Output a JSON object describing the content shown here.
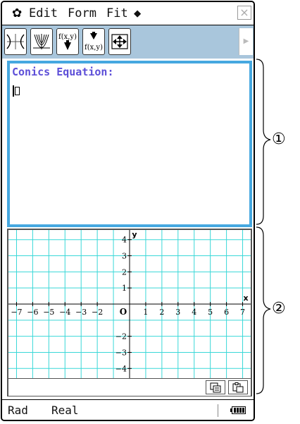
{
  "menu": {
    "gear_icon": "gear-icon",
    "items": [
      "Edit",
      "Form",
      "Fit",
      "◆"
    ],
    "close_label": "×"
  },
  "toolbar": {
    "buttons": [
      "hyperbola-icon",
      "parabola-family-icon",
      "f(x,y) down",
      "f(x,y) up",
      "fullscreen-icon"
    ],
    "scroll_right": "▶"
  },
  "equation_panel": {
    "title": "Conics Equation:",
    "input_value": ""
  },
  "graph": {
    "x_ticks": [
      "−7",
      "−6",
      "−5",
      "−4",
      "−3",
      "−2",
      "O",
      "1",
      "2",
      "3",
      "4",
      "5",
      "6",
      "7"
    ],
    "y_ticks_pos": [
      "4",
      "3",
      "2",
      "1"
    ],
    "y_ticks_neg": [
      "−2",
      "−3",
      "−4"
    ],
    "x_axis_label": "x",
    "y_axis_label": "y",
    "xlim": [
      -7.5,
      7.5
    ],
    "ylim": [
      -4.6,
      4.6
    ],
    "grid_color": "#3ad8d8"
  },
  "status": {
    "angle_mode": "Rad",
    "number_mode": "Real"
  },
  "callouts": {
    "one": "①",
    "two": "②"
  }
}
